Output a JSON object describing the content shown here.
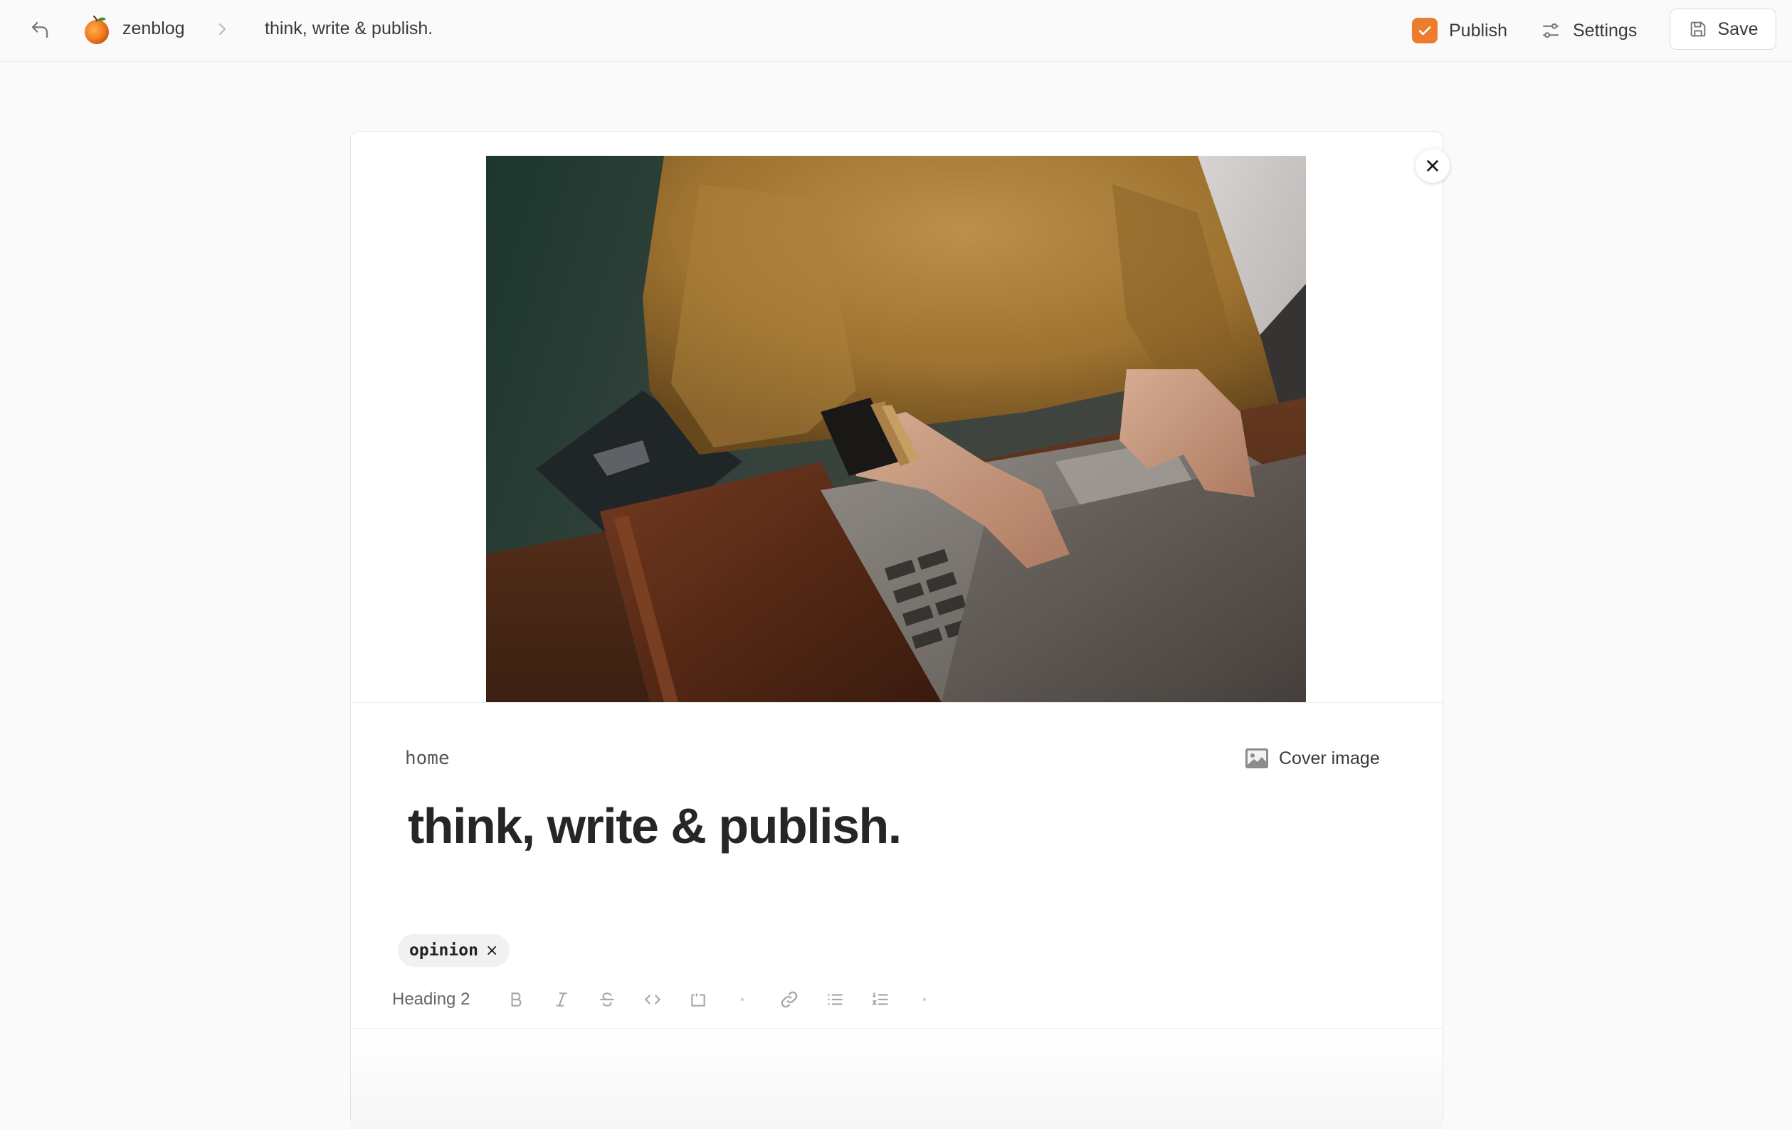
{
  "topbar": {
    "brand": "zenblog",
    "breadcrumb_title": "think, write & publish.",
    "publish_label": "Publish",
    "settings_label": "Settings",
    "save_label": "Save"
  },
  "post": {
    "collection": "home",
    "cover_button_label": "Cover image",
    "title": "think, write & publish.",
    "tags": [
      {
        "label": "opinion",
        "remove": "×"
      }
    ]
  },
  "toolbar": {
    "heading_label": "Heading 2",
    "tools": [
      "bold-icon",
      "italic-icon",
      "strikethrough-icon",
      "code-icon",
      "code-block-icon",
      "link-icon",
      "bullet-list-icon",
      "ordered-list-icon"
    ]
  },
  "colors": {
    "accent": "#ec7d2f",
    "background": "#fafafa",
    "card": "#ffffff",
    "text": "#2a2a2a",
    "muted_icon": "#a8a8a8"
  }
}
